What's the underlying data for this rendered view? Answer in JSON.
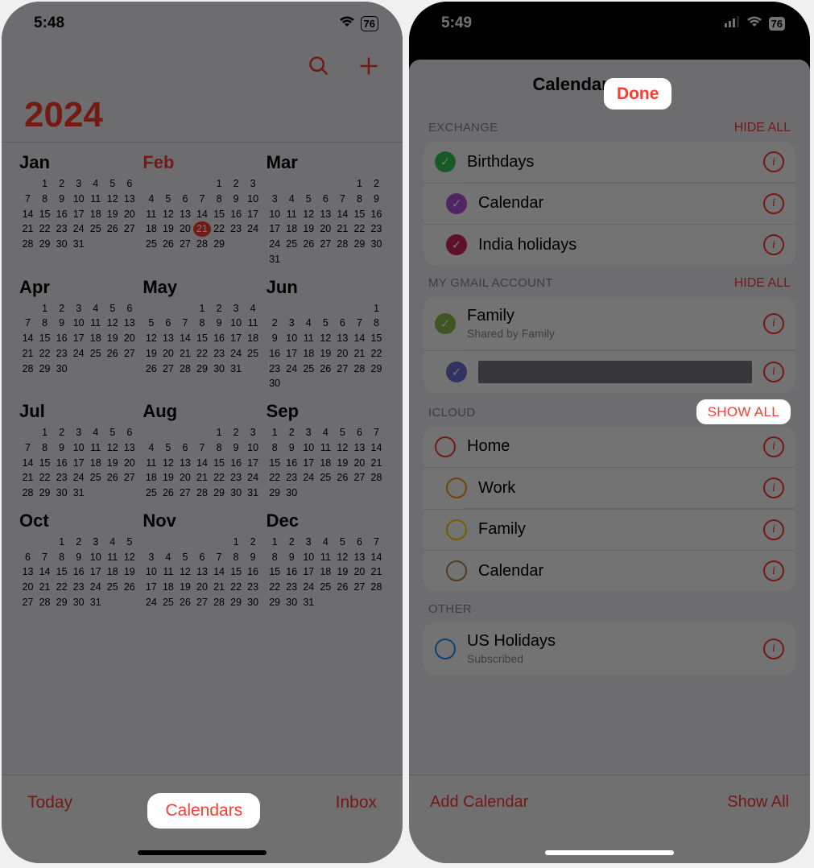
{
  "left": {
    "status": {
      "time": "5:48",
      "battery": "76"
    },
    "year": "2024",
    "current_month_index": 1,
    "today_day": 21,
    "months": [
      {
        "name": "Jan",
        "start": 1,
        "len": 31
      },
      {
        "name": "Feb",
        "start": 4,
        "len": 29
      },
      {
        "name": "Mar",
        "start": 5,
        "len": 31
      },
      {
        "name": "Apr",
        "start": 1,
        "len": 30
      },
      {
        "name": "May",
        "start": 3,
        "len": 31
      },
      {
        "name": "Jun",
        "start": 6,
        "len": 30
      },
      {
        "name": "Jul",
        "start": 1,
        "len": 31
      },
      {
        "name": "Aug",
        "start": 4,
        "len": 31
      },
      {
        "name": "Sep",
        "start": 0,
        "len": 30
      },
      {
        "name": "Oct",
        "start": 2,
        "len": 31
      },
      {
        "name": "Nov",
        "start": 5,
        "len": 30
      },
      {
        "name": "Dec",
        "start": 0,
        "len": 31
      }
    ],
    "bottom": {
      "today": "Today",
      "calendars": "Calendars",
      "inbox": "Inbox"
    }
  },
  "right": {
    "status": {
      "time": "5:49",
      "battery": "76"
    },
    "sheet_title": "Calendars",
    "done": "Done",
    "sections": [
      {
        "title": "EXCHANGE",
        "action": "HIDE ALL",
        "highlighted": false,
        "items": [
          {
            "type": "dot",
            "color": "#34c759",
            "label": "Birthdays"
          },
          {
            "type": "dot",
            "color": "#af52de",
            "label": "Calendar"
          },
          {
            "type": "dot",
            "color": "#d1235b",
            "label": "India holidays"
          }
        ]
      },
      {
        "title": "MY GMAIL ACCOUNT",
        "action": "HIDE ALL",
        "highlighted": false,
        "items": [
          {
            "type": "dot",
            "color": "#8bbf4a",
            "label": "Family",
            "sub": "Shared by Family"
          },
          {
            "type": "dot",
            "color": "#6b6fd6",
            "label": "",
            "redacted": true
          }
        ]
      },
      {
        "title": "ICLOUD",
        "action": "SHOW ALL",
        "highlighted": true,
        "items": [
          {
            "type": "ring",
            "color": "#ff3b30",
            "label": "Home"
          },
          {
            "type": "ring",
            "color": "#ff9500",
            "label": "Work"
          },
          {
            "type": "ring",
            "color": "#ffcc00",
            "label": "Family"
          },
          {
            "type": "ring",
            "color": "#b08850",
            "label": "Calendar"
          }
        ]
      },
      {
        "title": "OTHER",
        "action": "",
        "highlighted": false,
        "items": [
          {
            "type": "ring",
            "color": "#2196f3",
            "label": "US Holidays",
            "sub": "Subscribed"
          }
        ]
      }
    ],
    "bottom": {
      "add": "Add Calendar",
      "showall": "Show All"
    }
  }
}
